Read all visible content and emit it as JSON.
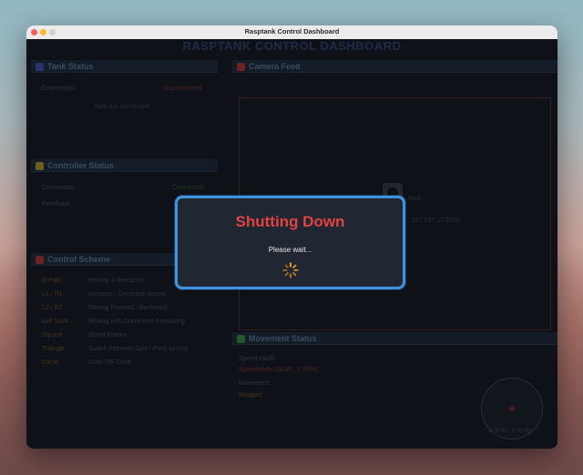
{
  "window": {
    "title": "Rasptank Control Dashboard"
  },
  "app": {
    "title": "RASPTANK CONTROL DASHBOARD"
  },
  "tank_status": {
    "title": "Tank Status",
    "connection_label": "Connection:",
    "connection_value": "Disconnected",
    "message": "Tank not connected",
    "color": "#3a3f9a"
  },
  "controller_status": {
    "title": "Controller Status",
    "connection_label": "Connection:",
    "connection_value": "Connected",
    "feedback_label": "Feedback:",
    "color": "#9a8a2a"
  },
  "control_scheme": {
    "title": "Control Scheme",
    "color": "#a83232",
    "rows": [
      {
        "key": "D-Pad",
        "desc": "Moving 4 directions"
      },
      {
        "key": "L1 / R1",
        "desc": "Increase / Decrease Speed"
      },
      {
        "key": "L2 / R2",
        "desc": "Moving Forward / Backward"
      },
      {
        "key": "Left Stick",
        "desc": "Moving with Curve turn if thrusting"
      },
      {
        "key": "Square",
        "desc": "Shoot Enemy"
      },
      {
        "key": "Triangle",
        "desc": "Switch between Spin / Pivot turning"
      },
      {
        "key": "Circle",
        "desc": "Scan QR Code"
      }
    ]
  },
  "camera_feed": {
    "title": "Camera Feed",
    "color": "#a83232",
    "text1": "feed",
    "text2": ".157.167.12:5000"
  },
  "movement_status": {
    "title": "Movement Status",
    "color": "#2e8a3a",
    "speed_label": "Speed Mode:",
    "speed_value": "SpeedMode.GEAR_3 (60%)",
    "movement_label": "Movement:",
    "movement_value": "Stopped",
    "joystick_readout": "X: 0.00, Y: 0.00"
  },
  "modal": {
    "title": "Shutting Down",
    "message": "Please wait...",
    "accent": "#3f92de",
    "title_color": "#e34242",
    "spinner_color": "#f0a020"
  }
}
